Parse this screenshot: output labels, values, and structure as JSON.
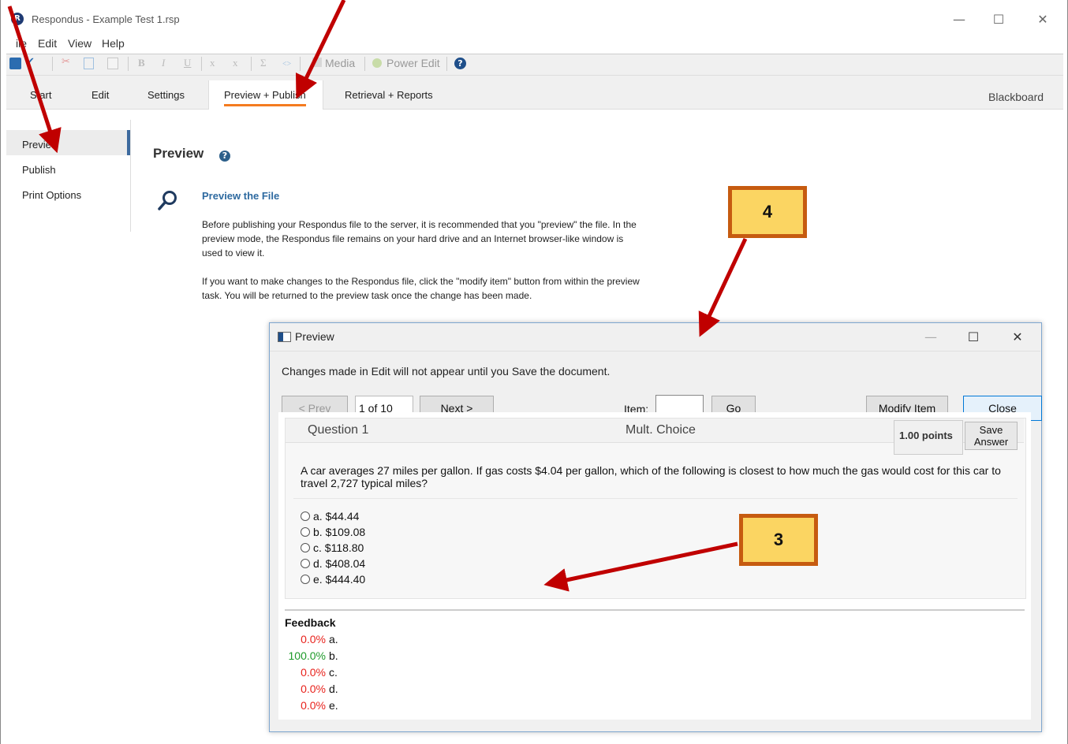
{
  "window": {
    "title": "Respondus - Example Test 1.rsp",
    "logo_letter": "R",
    "blackboard_label": "Blackboard"
  },
  "menu": [
    "ile",
    "Edit",
    "View",
    "Help"
  ],
  "toolbar": {
    "bold": "B",
    "italic": "I",
    "underline": "U",
    "subscript": "x",
    "superscript": "x",
    "sigma": "Σ",
    "code": "<>",
    "media": "Media",
    "power_edit": "Power Edit",
    "help": "?"
  },
  "tabs": [
    "S art",
    "Edit",
    "Settings",
    "Preview + Publish",
    "Retrieval + Reports"
  ],
  "sidebar": {
    "items": [
      "Preview",
      "Publish",
      "Print Options"
    ],
    "active": "Preview"
  },
  "main": {
    "title": "Preview",
    "help": "?",
    "subtitle": "Preview the File",
    "para1": "Before publishing your Respondus file to the server, it is recommended that you \"preview\" the file.  In the preview mode, the Respondus file remains on your hard drive and an Internet browser-like window is used to view it.",
    "para2": "If you want to make changes to the Respondus file, click the \"modify item\" button from within the preview task.  You will be returned to the preview task once the change has been made."
  },
  "dialog": {
    "title": "Preview",
    "notice": "Changes made in Edit will not appear until you Save the document.",
    "prev_label": "< Prev",
    "page_value": "1 of 10",
    "next_label": "Next  >",
    "item_label": "Item:",
    "item_value": "",
    "go_label": "Go",
    "modify_label": "Modify Item",
    "close_label": "Close",
    "question": {
      "number": "Question 1",
      "type": "Mult. Choice",
      "points": "1.00 points",
      "save_label": "Save Answer",
      "stem": "A car averages 27 miles per gallon. If gas costs $4.04 per gallon, which of the following is closest to how much the gas would cost for this car to travel 2,727 typical miles?",
      "choices": [
        "a. $44.44",
        "b. $109.08",
        "c. $118.80",
        "d. $408.04",
        "e. $444.40"
      ]
    },
    "feedback": {
      "title": "Feedback",
      "rows": [
        {
          "pct": "0.0%",
          "letter": "a.",
          "color": "#e8221c"
        },
        {
          "pct": "100.0%",
          "letter": "b.",
          "color": "#1e9a2a"
        },
        {
          "pct": "0.0%",
          "letter": "c.",
          "color": "#e8221c"
        },
        {
          "pct": "0.0%",
          "letter": "d.",
          "color": "#e8221c"
        },
        {
          "pct": "0.0%",
          "letter": "e.",
          "color": "#e8221c"
        }
      ]
    }
  },
  "callouts": [
    "4",
    "3"
  ],
  "colors": {
    "accent_tab": "#f47b20",
    "arrow": "#c00000",
    "callout_fill": "#fbd562",
    "callout_border": "#c65b10"
  }
}
